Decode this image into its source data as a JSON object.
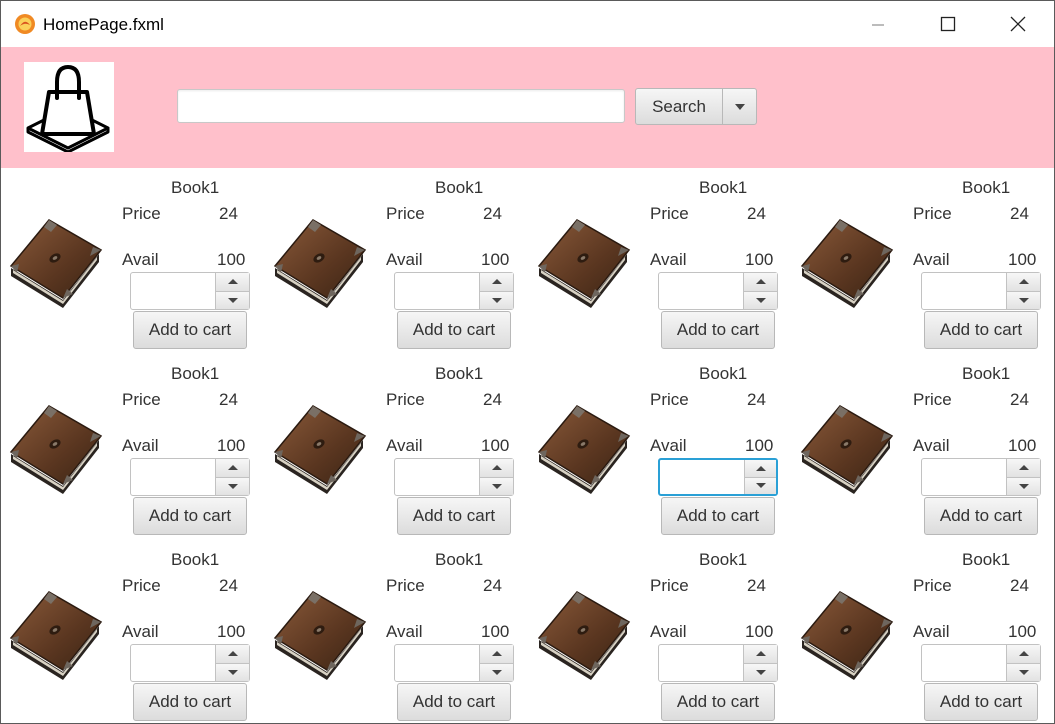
{
  "window": {
    "title": "HomePage.fxml"
  },
  "header": {
    "search_placeholder": "",
    "search_value": "",
    "search_label": "Search",
    "background": "#ffc0cb"
  },
  "products": [
    {
      "name": "Book1",
      "price_label": "Price",
      "price": "24",
      "avail_label": "Avail",
      "avail": "100",
      "qty": "",
      "button": "Add to cart"
    },
    {
      "name": "Book1",
      "price_label": "Price",
      "price": "24",
      "avail_label": "Avail",
      "avail": "100",
      "qty": "",
      "button": "Add to cart"
    },
    {
      "name": "Book1",
      "price_label": "Price",
      "price": "24",
      "avail_label": "Avail",
      "avail": "100",
      "qty": "",
      "button": "Add to cart"
    },
    {
      "name": "Book1",
      "price_label": "Price",
      "price": "24",
      "avail_label": "Avail",
      "avail": "100",
      "qty": "",
      "button": "Add to cart"
    },
    {
      "name": "Book1",
      "price_label": "Price",
      "price": "24",
      "avail_label": "Avail",
      "avail": "100",
      "qty": "",
      "button": "Add to cart"
    },
    {
      "name": "Book1",
      "price_label": "Price",
      "price": "24",
      "avail_label": "Avail",
      "avail": "100",
      "qty": "",
      "button": "Add to cart"
    },
    {
      "name": "Book1",
      "price_label": "Price",
      "price": "24",
      "avail_label": "Avail",
      "avail": "100",
      "qty": "",
      "button": "Add to cart",
      "focused": true
    },
    {
      "name": "Book1",
      "price_label": "Price",
      "price": "24",
      "avail_label": "Avail",
      "avail": "100",
      "qty": "",
      "button": "Add to cart"
    },
    {
      "name": "Book1",
      "price_label": "Price",
      "price": "24",
      "avail_label": "Avail",
      "avail": "100",
      "qty": "",
      "button": "Add to cart"
    },
    {
      "name": "Book1",
      "price_label": "Price",
      "price": "24",
      "avail_label": "Avail",
      "avail": "100",
      "qty": "",
      "button": "Add to cart"
    },
    {
      "name": "Book1",
      "price_label": "Price",
      "price": "24",
      "avail_label": "Avail",
      "avail": "100",
      "qty": "",
      "button": "Add to cart"
    },
    {
      "name": "Book1",
      "price_label": "Price",
      "price": "24",
      "avail_label": "Avail",
      "avail": "100",
      "qty": "",
      "button": "Add to cart"
    }
  ],
  "icons": {
    "app": "app-logo-icon",
    "logo": "shopping-bag-icon",
    "book": "book-icon",
    "dropdown": "chevron-down-icon",
    "spin_up": "triangle-up-icon",
    "spin_down": "triangle-down-icon"
  },
  "colors": {
    "focus": "#2aa0d6",
    "header": "#ffc0cb"
  }
}
